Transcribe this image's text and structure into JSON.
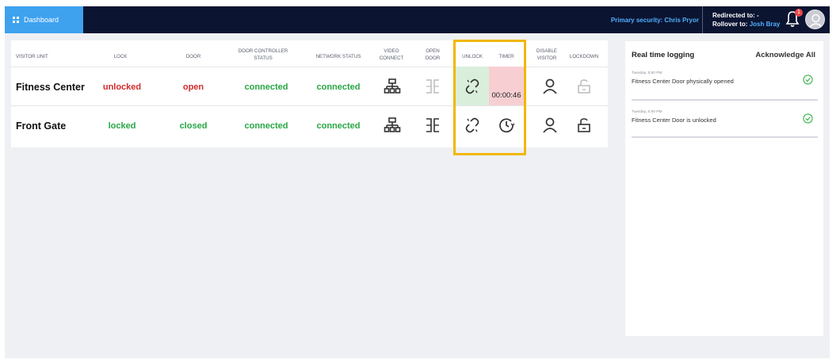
{
  "topbar": {
    "dashboard_label": "Dashboard",
    "primary_security_label": "Primary security: Chris Pryor",
    "redirected_label": "Redirected to:",
    "redirected_value": "-",
    "rollover_label": "Rollover to:",
    "rollover_value": "Josh Bray",
    "notification_count": "1"
  },
  "table": {
    "headers": {
      "visitor_unit": "VISITOR UNIT",
      "lock": "LOCK",
      "door": "DOOR",
      "door_controller_status_1": "DOOR CONTROLLER",
      "door_controller_status_2": "STATUS",
      "network_status": "NETWORK STATUS",
      "video_connect_1": "VIDEO",
      "video_connect_2": "CONNECT",
      "open_door_1": "OPEN",
      "open_door_2": "DOOR",
      "unlock": "UNLOCK",
      "timer": "TIMER",
      "disable_visitor_1": "DISABLE",
      "disable_visitor_2": "VISITOR",
      "lockdown": "LOCKDOWN"
    },
    "rows": [
      {
        "name": "Fitness Center",
        "lock": "unlocked",
        "door": "open",
        "controller": "connected",
        "network": "connected",
        "timer": "00:00:46"
      },
      {
        "name": "Front Gate",
        "lock": "locked",
        "door": "closed",
        "controller": "connected",
        "network": "connected"
      }
    ]
  },
  "icons": {
    "dashboard": "grid-icon",
    "bell": "bell-icon",
    "avatar": "user-avatar-icon",
    "video_connect": "network-icon",
    "open_door": "door-icon",
    "unlock": "broken-link-icon",
    "timer": "timer-icon",
    "disable_visitor": "person-icon",
    "lockdown": "padlock-icon",
    "acknowledge": "check-circle-icon"
  },
  "colors": {
    "topbar": "#0b1430",
    "accent_blue": "#3ea2ef",
    "status_red": "#d12b2b",
    "status_green": "#28a745",
    "unlock_active": "#d9efdc",
    "timer_active": "#f7cfd3",
    "highlight": "#f2b705"
  },
  "log": {
    "title": "Real time logging",
    "acknowledge_all": "Acknowledge All",
    "entries": [
      {
        "time": "Tuesday, 5:50 PM",
        "unit": "Fitness Center",
        "message": "Door physically opened"
      },
      {
        "time": "Tuesday, 5:50 PM",
        "unit": "Fitness Center",
        "message": "Door is unlocked"
      }
    ]
  }
}
